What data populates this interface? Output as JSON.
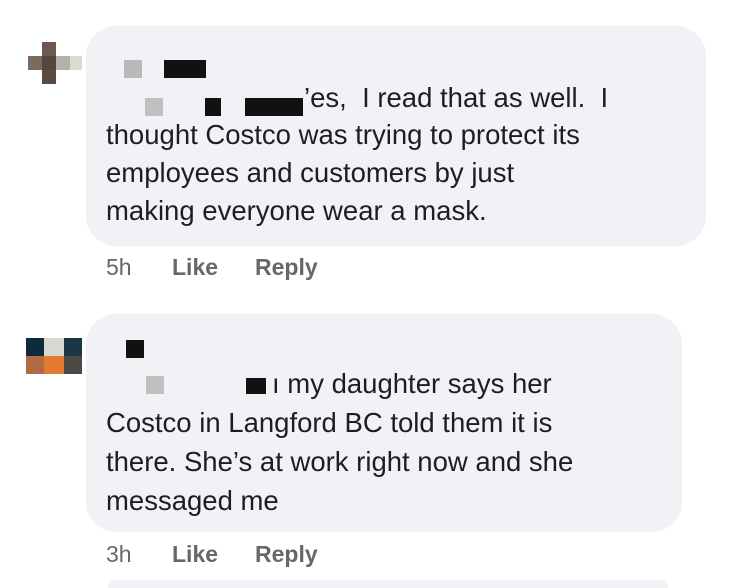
{
  "comments": [
    {
      "text_lines": [
        "Yes,  I read that as well.  I",
        "thought Costco was trying to protect its",
        "employees and customers by just",
        "making everyone wear a mask."
      ],
      "first_line_visible": "’es,  I read that as well.  I",
      "time": "5h",
      "like_label": "Like",
      "reply_label": "Reply"
    },
    {
      "text_lines": [
        "...n my daughter says her",
        "Costco in Langford BC told them it is",
        "there. She’s at work right now and she",
        "messaged me"
      ],
      "first_line_visible": "ı my daughter says her",
      "time": "3h",
      "like_label": "Like",
      "reply_label": "Reply"
    }
  ],
  "colors": {
    "bubble": "#f0f2f5",
    "text": "#1c1e21",
    "meta": "#65676b"
  }
}
